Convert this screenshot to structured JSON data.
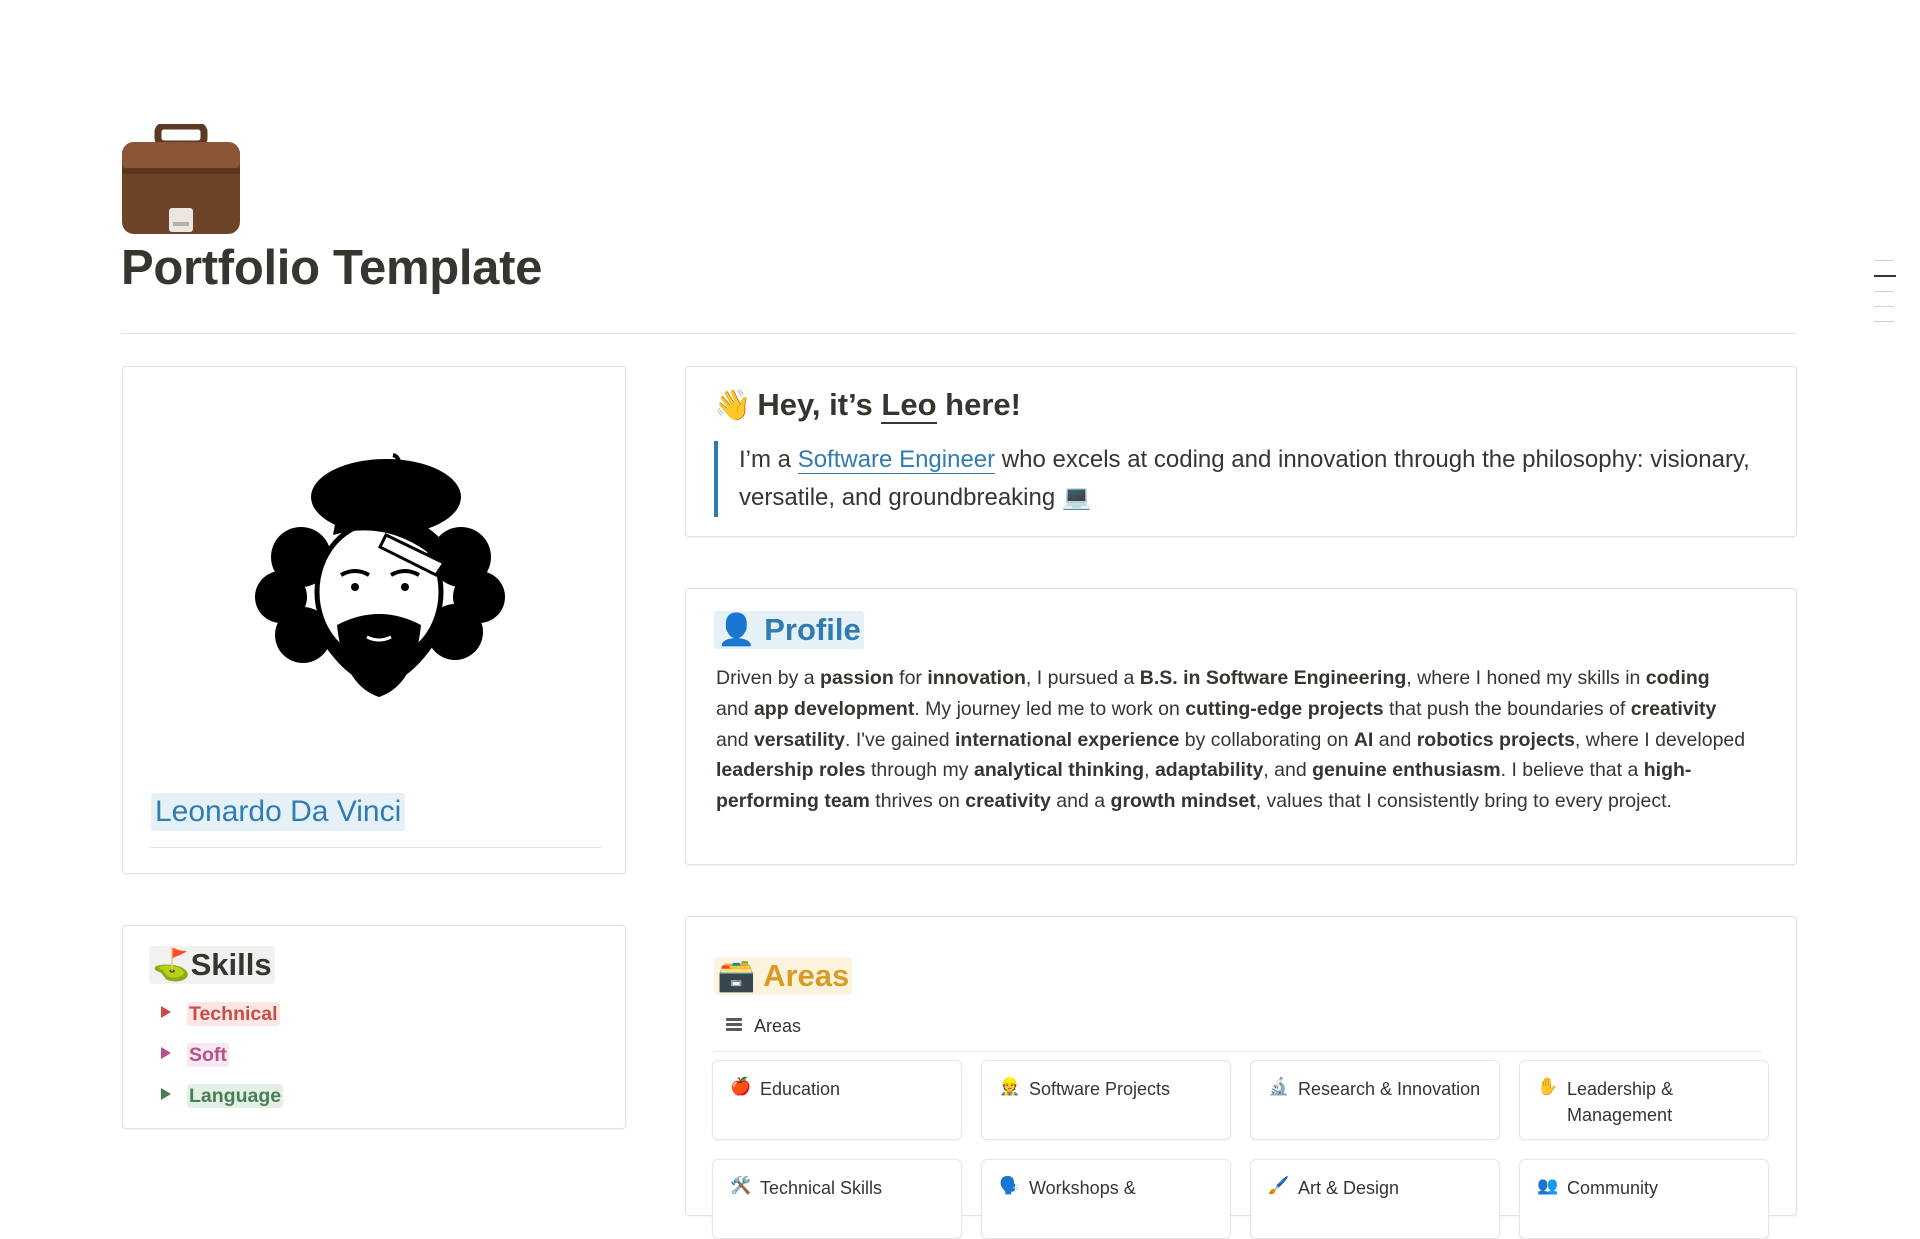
{
  "page": {
    "title": "Portfolio Template",
    "icon": "briefcase-icon"
  },
  "avatar_card": {
    "name": "Leonardo Da Vinci"
  },
  "hero": {
    "emoji": "👋",
    "heading_prefix": "Hey, it’s ",
    "heading_name": "Leo",
    "heading_suffix": " here!",
    "quote_prefix": "I’m a ",
    "quote_link": "Software Engineer",
    "quote_suffix": " who excels at coding and innovation through the philosophy: visionary, versatile, and groundbreaking",
    "quote_emoji": "💻"
  },
  "profile": {
    "emoji": "👤",
    "heading": "Profile",
    "segments": [
      [
        "Driven by a ",
        false
      ],
      [
        "passion",
        true
      ],
      [
        " for ",
        false
      ],
      [
        "innovation",
        true
      ],
      [
        ", I pursued a ",
        false
      ],
      [
        "B.S. in Software Engineering",
        true
      ],
      [
        ", where I honed my skills in ",
        false
      ],
      [
        "coding",
        true
      ],
      [
        " and ",
        false
      ],
      [
        "app development",
        true
      ],
      [
        ". My journey led me to work on ",
        false
      ],
      [
        "cutting-edge projects",
        true
      ],
      [
        " that push the boundaries of ",
        false
      ],
      [
        "creativity",
        true
      ],
      [
        " and ",
        false
      ],
      [
        "versatility",
        true
      ],
      [
        ". I've gained ",
        false
      ],
      [
        "international experience",
        true
      ],
      [
        " by collaborating on ",
        false
      ],
      [
        "AI",
        true
      ],
      [
        " and ",
        false
      ],
      [
        "robotics projects",
        true
      ],
      [
        ", where I developed ",
        false
      ],
      [
        "leadership roles",
        true
      ],
      [
        " through my ",
        false
      ],
      [
        "analytical thinking",
        true
      ],
      [
        ", ",
        false
      ],
      [
        "adaptability",
        true
      ],
      [
        ", and ",
        false
      ],
      [
        "genuine enthusiasm",
        true
      ],
      [
        ". I believe that a ",
        false
      ],
      [
        "high-performing team",
        true
      ],
      [
        " thrives on ",
        false
      ],
      [
        "creativity",
        true
      ],
      [
        " and a ",
        false
      ],
      [
        "growth mindset",
        true
      ],
      [
        ", values that I consistently bring to every project.",
        false
      ]
    ]
  },
  "skills": {
    "emoji": "⛳",
    "heading": "Skills",
    "items": [
      "Technical",
      "Soft",
      "Language"
    ]
  },
  "areas": {
    "emoji": "🗃️",
    "heading": "Areas",
    "database_title": "Areas",
    "cards": [
      {
        "icon": "🍎",
        "label": "Education"
      },
      {
        "icon": "👷",
        "label": "Software Projects"
      },
      {
        "icon": "🔬",
        "label": "Research & Innovation"
      },
      {
        "icon": "✋",
        "label": "Leadership & Management"
      },
      {
        "icon": "🛠️",
        "label": "Technical Skills"
      },
      {
        "icon": "🗣️",
        "label": "Workshops &"
      },
      {
        "icon": "🖌️",
        "label": "Art & Design"
      },
      {
        "icon": "👥",
        "label": "Community"
      }
    ]
  },
  "colors": {
    "blue": "#2e7cb2",
    "orange": "#d99a28",
    "red": "#c94d45",
    "pink": "#b84f8e",
    "green": "#478055"
  }
}
